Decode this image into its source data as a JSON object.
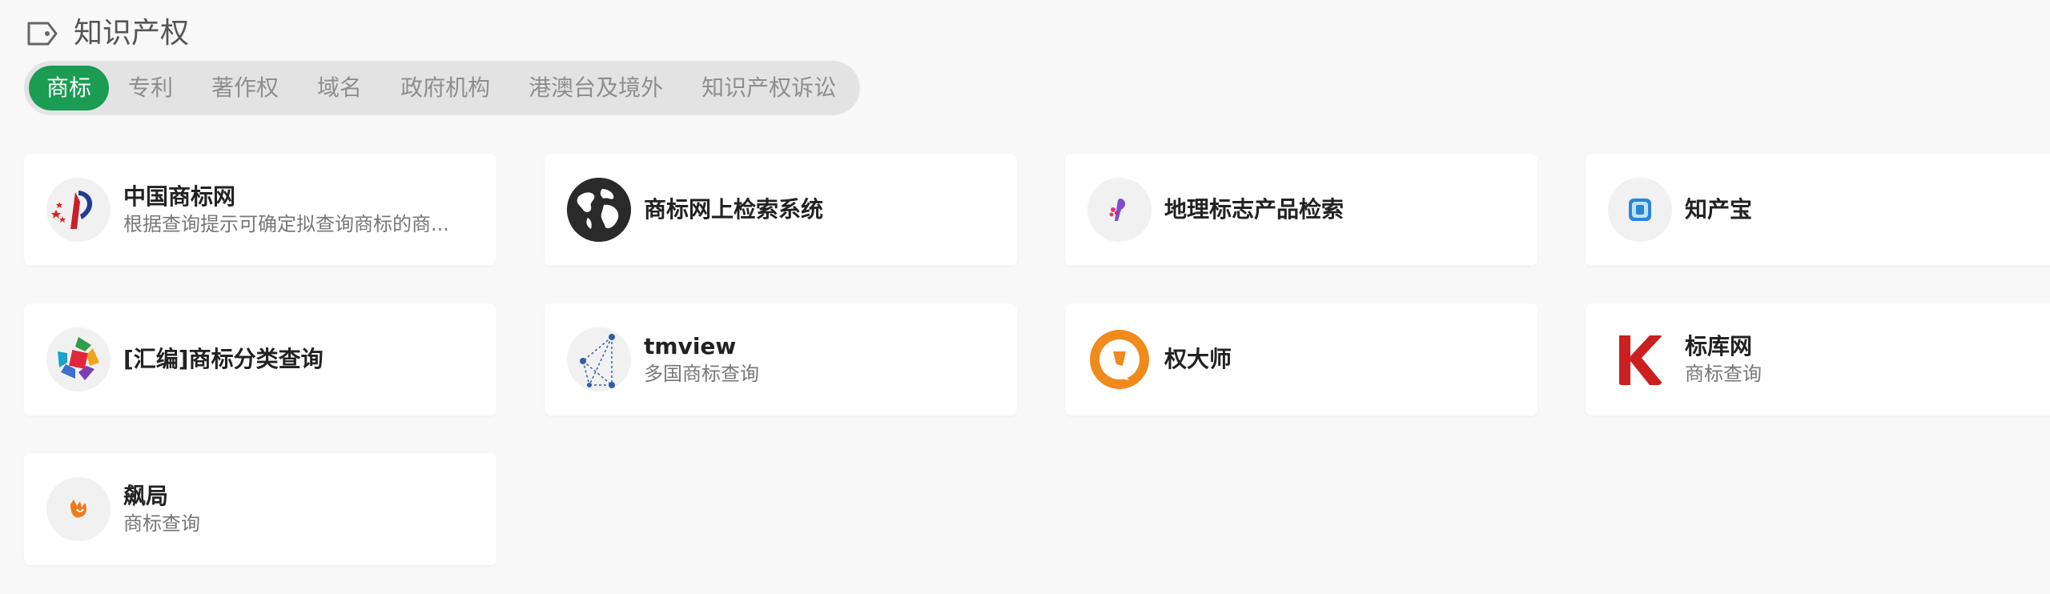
{
  "section": {
    "title": "知识产权",
    "icon": "tag-icon"
  },
  "tabs": [
    {
      "label": "商标",
      "active": true
    },
    {
      "label": "专利",
      "active": false
    },
    {
      "label": "著作权",
      "active": false
    },
    {
      "label": "域名",
      "active": false
    },
    {
      "label": "政府机构",
      "active": false
    },
    {
      "label": "港澳台及境外",
      "active": false
    },
    {
      "label": "知识产权诉讼",
      "active": false
    }
  ],
  "accent_color": "#1a9c53",
  "cards": [
    {
      "title": "中国商标网",
      "desc": "根据查询提示可确定拟查询商标的商...",
      "icon": "china-trademark-logo-icon"
    },
    {
      "title": "商标网上检索系统",
      "desc": "",
      "icon": "globe-icon"
    },
    {
      "title": "地理标志产品检索",
      "desc": "",
      "icon": "geo-indication-logo-icon"
    },
    {
      "title": "知产宝",
      "desc": "",
      "icon": "zhichanbao-logo-icon"
    },
    {
      "title": "[汇编]商标分类查询",
      "desc": "",
      "icon": "classification-logo-icon"
    },
    {
      "title": "tmview",
      "desc": "多国商标查询",
      "icon": "tmview-logo-icon"
    },
    {
      "title": "权大师",
      "desc": "",
      "icon": "quandashi-logo-icon"
    },
    {
      "title": "标库网",
      "desc": "商标查询",
      "icon": "biaoku-logo-icon"
    },
    {
      "title": "飙局",
      "desc": "商标查询",
      "icon": "biaoju-logo-icon"
    }
  ]
}
